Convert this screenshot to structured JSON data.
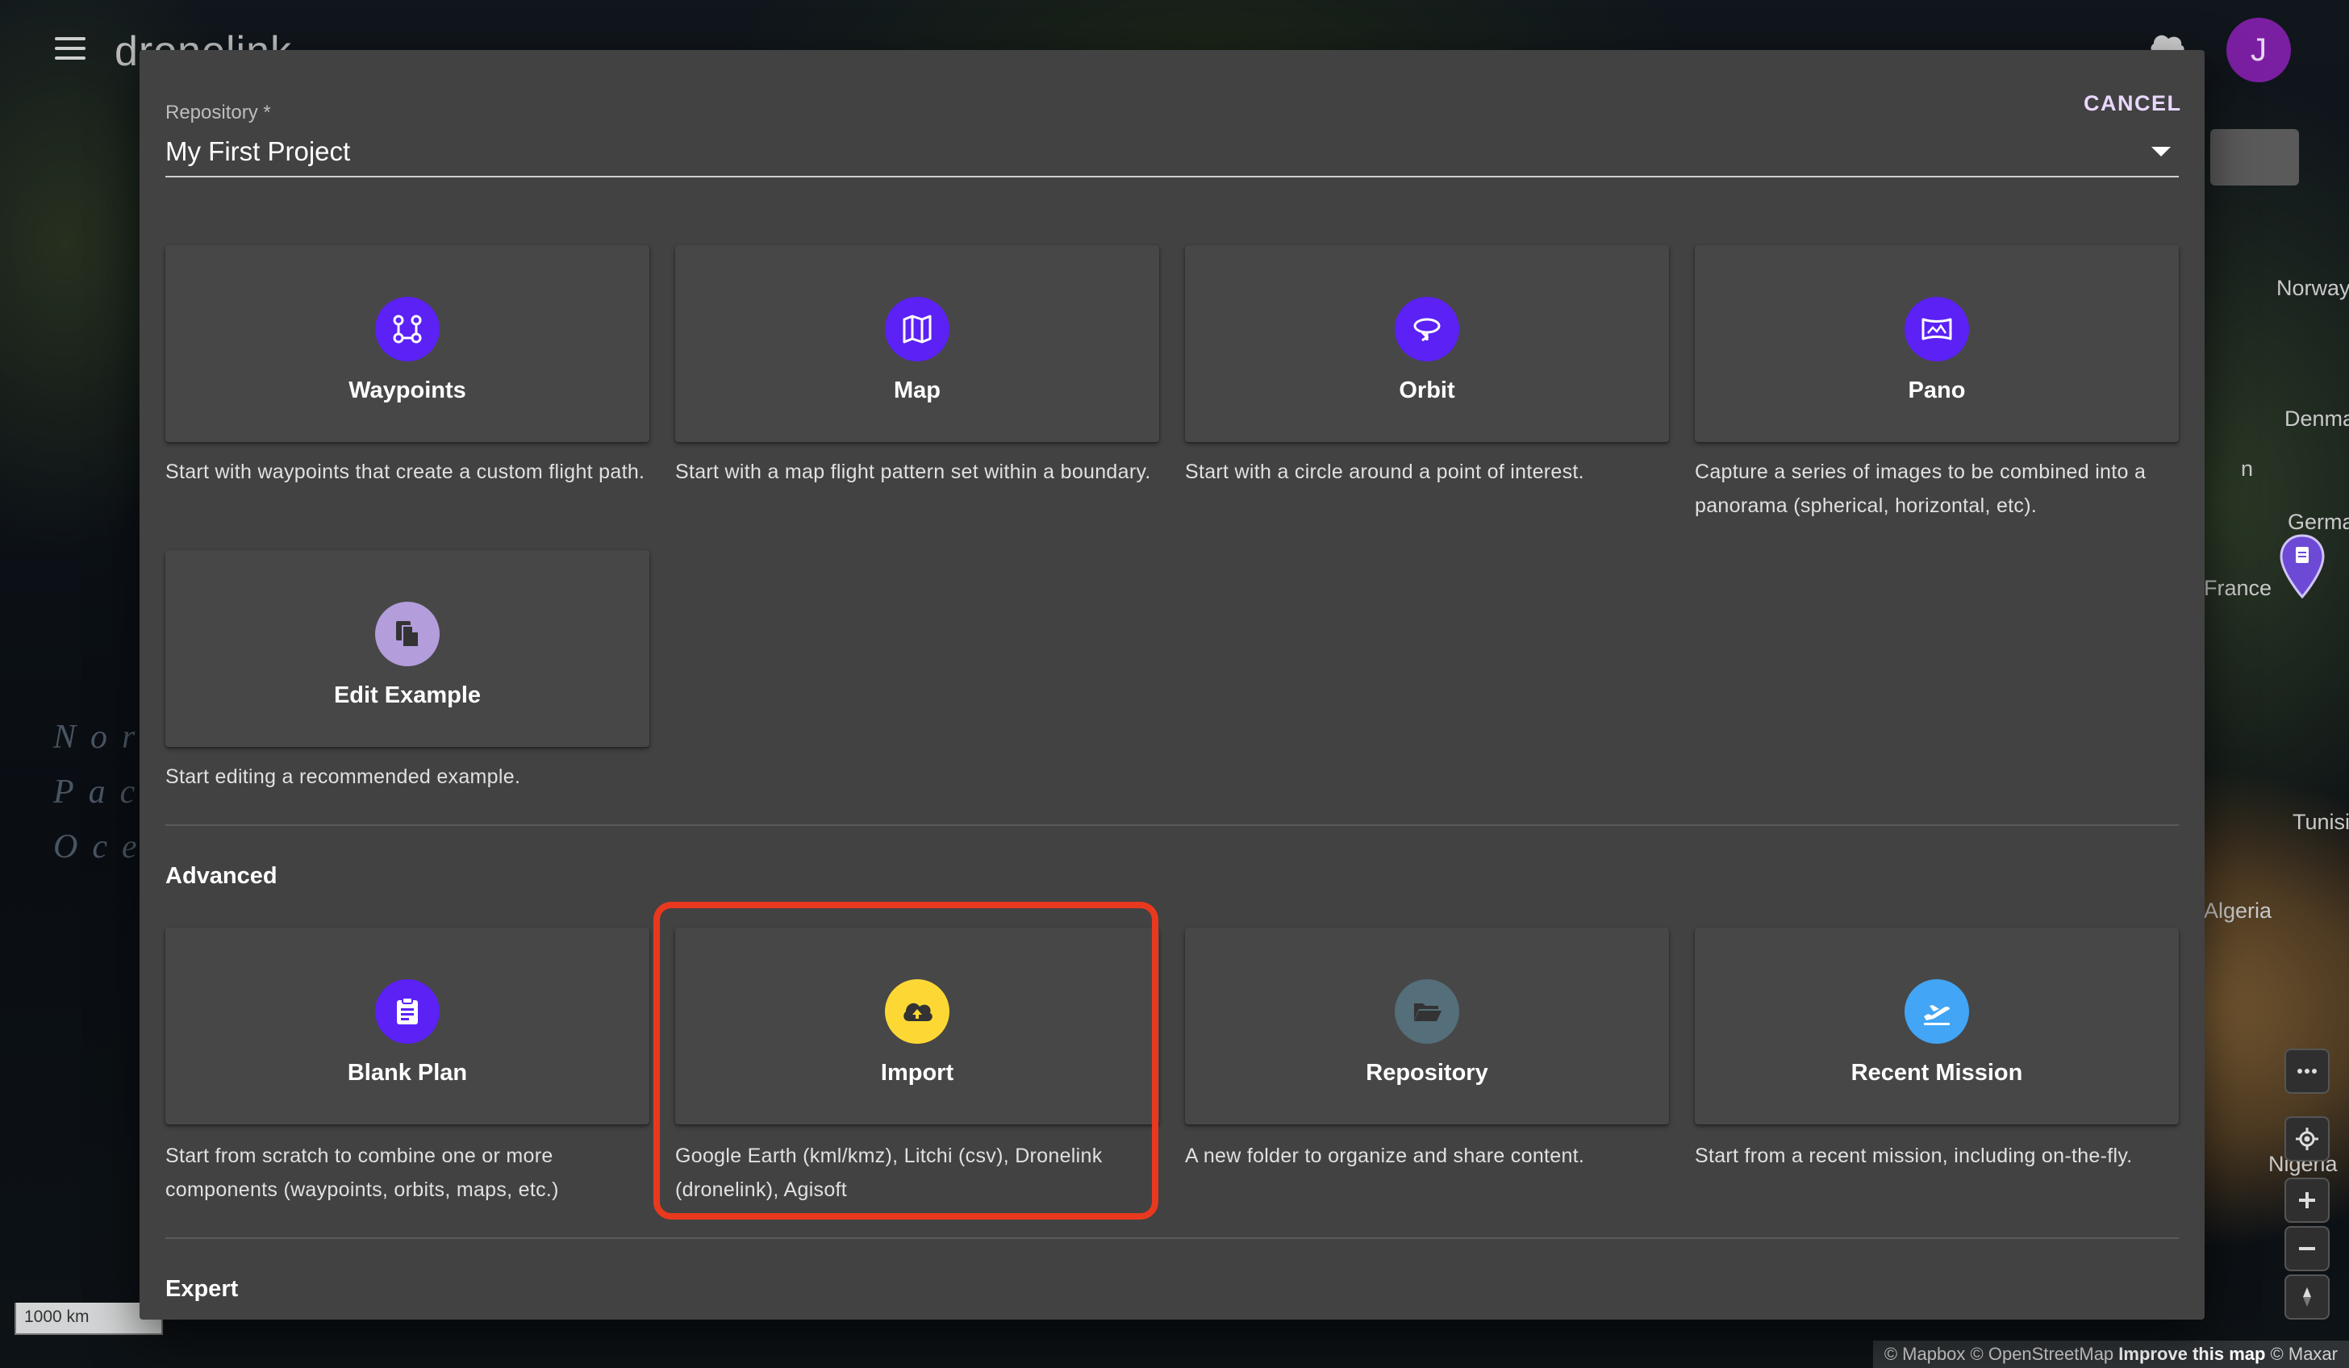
{
  "app": {
    "logo": "dronelink",
    "avatar_initial": "J"
  },
  "map": {
    "ocean_label_lines": [
      "Nor",
      "Pac",
      "Oce"
    ],
    "countries": [
      "Norway",
      "Denma",
      "Germa",
      "France",
      "Tunisi",
      "Algeria",
      "Nigeria",
      "n"
    ],
    "scale": "1000 km",
    "attribution_prefix": "© Mapbox © OpenStreetMap ",
    "attribution_link": "Improve this map",
    "attribution_suffix": " © Maxar"
  },
  "dialog": {
    "cancel_label": "CANCEL",
    "repository_label": "Repository *",
    "repository_value": "My First Project",
    "basic_cards": [
      {
        "title": "Waypoints",
        "description": "Start with waypoints that create a custom flight path.",
        "icon": "waypoints-icon",
        "color": "#5b21f5"
      },
      {
        "title": "Map",
        "description": "Start with a map flight pattern set within a boundary.",
        "icon": "map-icon",
        "color": "#5b21f5"
      },
      {
        "title": "Orbit",
        "description": "Start with a circle around a point of interest.",
        "icon": "orbit-icon",
        "color": "#5b21f5"
      },
      {
        "title": "Pano",
        "description": "Capture a series of images to be combined into a panorama (spherical, horizontal, etc).",
        "icon": "pano-icon",
        "color": "#5b21f5"
      },
      {
        "title": "Edit Example",
        "description": "Start editing a recommended example.",
        "icon": "copy-icon",
        "color": "#b39ddb"
      }
    ],
    "advanced_title": "Advanced",
    "advanced_cards": [
      {
        "title": "Blank Plan",
        "description": "Start from scratch to combine one or more components (waypoints, orbits, maps, etc.)",
        "icon": "clipboard-icon",
        "color": "#5b21f5"
      },
      {
        "title": "Import",
        "description": "Google Earth (kml/kmz), Litchi (csv), Dronelink (dronelink), Agisoft",
        "icon": "cloud-upload-icon",
        "color": "#fdd835"
      },
      {
        "title": "Repository",
        "description": "A new folder to organize and share content.",
        "icon": "folder-open-icon",
        "color": "#546e7a"
      },
      {
        "title": "Recent Mission",
        "description": "Start from a recent mission, including on-the-fly.",
        "icon": "flight-takeoff-icon",
        "color": "#42a5f5"
      }
    ],
    "expert_title": "Expert"
  }
}
